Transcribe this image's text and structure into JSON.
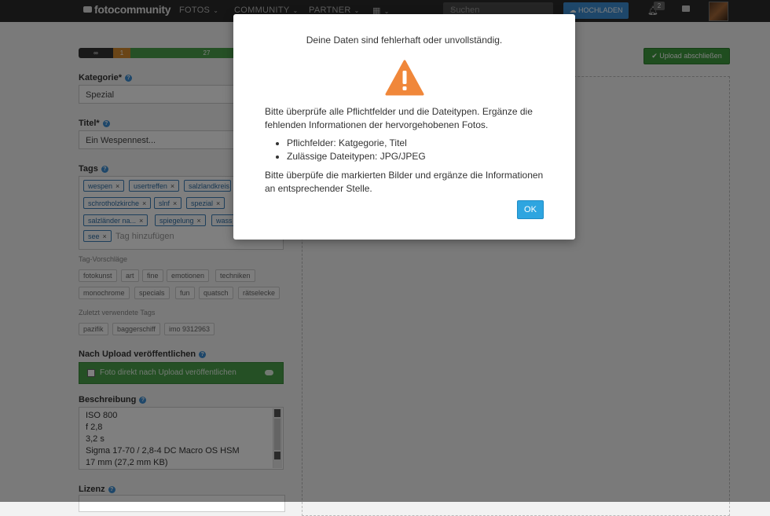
{
  "header": {
    "logo": "fotocommunity",
    "nav": [
      "FOTOS",
      "COMMUNITY",
      "PARTNER"
    ],
    "search_placeholder": "Suchen",
    "upload_button": "HOCHLADEN",
    "notification_count": "2"
  },
  "form": {
    "progress": {
      "segment1": "∞",
      "segment2": "1",
      "segment3": "27"
    },
    "category": {
      "label": "Kategorie*",
      "value": "Spezial"
    },
    "title": {
      "label": "Titel*",
      "value": "Ein Wespennest..."
    },
    "tags": {
      "label": "Tags",
      "items": [
        "wespen",
        "usertreffen",
        "salzlandkreis",
        "schrotholzkirche",
        "slnf",
        "spezial",
        "salzländer na...",
        "spiegelung",
        "wass",
        "see"
      ],
      "input_placeholder": "Tag hinzufügen"
    },
    "tag_suggestions": {
      "label": "Tag-Vorschläge",
      "items": [
        "fotokunst",
        "art",
        "fine",
        "emotionen",
        "techniken",
        "monochrome",
        "specials",
        "fun",
        "quatsch",
        "rätselecke"
      ]
    },
    "recent_tags": {
      "label": "Zuletzt verwendete Tags",
      "items": [
        "pazifik",
        "baggerschiff",
        "imo 9312963"
      ]
    },
    "publish": {
      "label": "Nach Upload veröffentlichen",
      "option": "Foto direkt nach Upload veröffentlichen"
    },
    "description": {
      "label": "Beschreibung",
      "lines": [
        "ISO 800",
        "f 2,8",
        "3,2 s",
        "Sigma 17-70 / 2,8-4 DC Macro OS HSM",
        "17 mm (27,2 mm KB)"
      ]
    },
    "license": {
      "label": "Lizenz"
    }
  },
  "finish_button": "Upload abschließen",
  "modal": {
    "title": "Deine Daten sind fehlerhaft oder unvollständig.",
    "paragraph1": "Bitte überprüfe alle Pflichtfelder und die Dateitypen. Ergänze die fehlenden Informationen der hervorgehobenen Fotos.",
    "list": [
      "Pflichfelder: Katgegorie, Titel",
      "Zulässige Dateitypen: JPG/JPEG"
    ],
    "paragraph2": "Bitte überpüfe die markierten Bilder und ergänze die Informationen an entsprechender Stelle.",
    "ok_button": "OK"
  },
  "colors": {
    "accent": "#3d8fd4",
    "success": "#4aa04a",
    "warning": "#f0873a",
    "ok_button": "#2ea5e0"
  }
}
